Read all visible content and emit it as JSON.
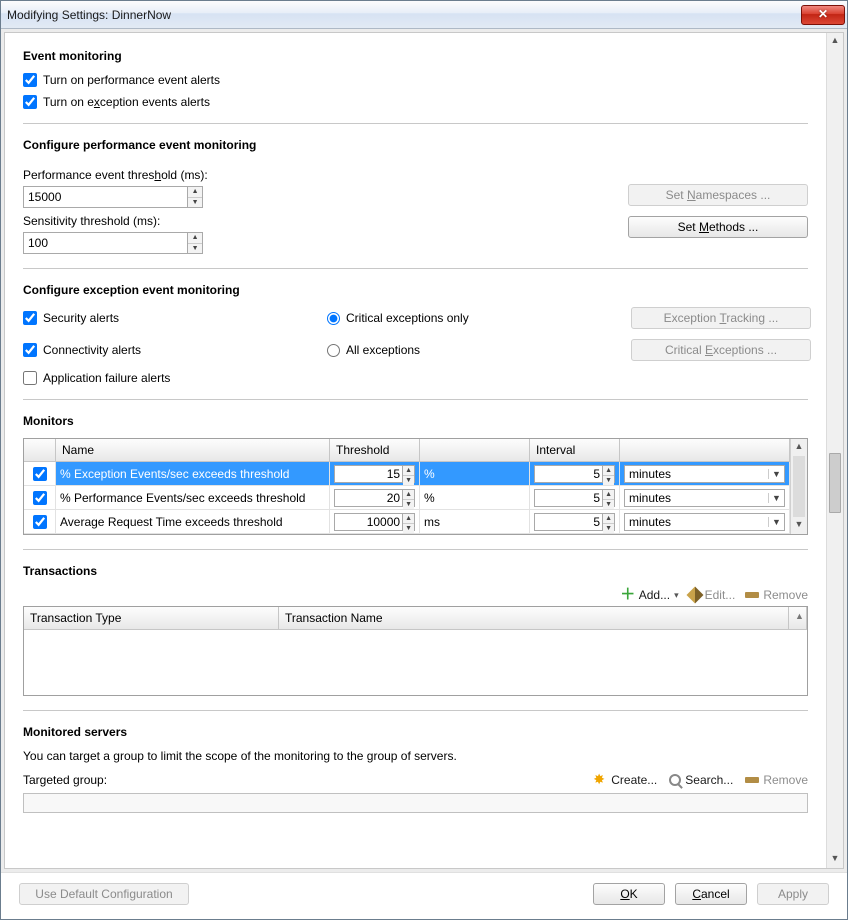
{
  "window": {
    "title": "Modifying Settings: DinnerNow"
  },
  "event_monitoring": {
    "heading": "Event monitoring",
    "perf_alerts_label": "Turn on performance event alerts",
    "perf_alerts_checked": true,
    "exc_alerts_label": "Turn on exception events alerts",
    "exc_alerts_checked": true
  },
  "configure_perf": {
    "heading": "Configure performance event monitoring",
    "threshold_label": "Performance event threshold (ms):",
    "threshold_value": "15000",
    "sensitivity_label": "Sensitivity threshold (ms):",
    "sensitivity_value": "100",
    "set_namespaces_label": "Set Namespaces ...",
    "set_methods_label": "Set Methods ..."
  },
  "configure_exc": {
    "heading": "Configure exception event monitoring",
    "security_label": "Security alerts",
    "security_checked": true,
    "connectivity_label": "Connectivity alerts",
    "connectivity_checked": true,
    "appfail_label": "Application failure alerts",
    "appfail_checked": false,
    "critical_only_label": "Critical exceptions only",
    "all_exceptions_label": "All exceptions",
    "radio_value": "critical",
    "exception_tracking_label": "Exception Tracking ...",
    "critical_exceptions_label": "Critical Exceptions ..."
  },
  "monitors": {
    "heading": "Monitors",
    "columns": {
      "name": "Name",
      "threshold": "Threshold",
      "interval": "Interval"
    },
    "rows": [
      {
        "checked": true,
        "name": "% Exception Events/sec exceeds threshold",
        "threshold": "15",
        "unit": "%",
        "interval": "5",
        "interval_unit": "minutes",
        "selected": true
      },
      {
        "checked": true,
        "name": "% Performance Events/sec exceeds threshold",
        "threshold": "20",
        "unit": "%",
        "interval": "5",
        "interval_unit": "minutes",
        "selected": false
      },
      {
        "checked": true,
        "name": "Average Request Time exceeds threshold",
        "threshold": "10000",
        "unit": "ms",
        "interval": "5",
        "interval_unit": "minutes",
        "selected": false
      }
    ]
  },
  "transactions": {
    "heading": "Transactions",
    "add_label": "Add...",
    "edit_label": "Edit...",
    "remove_label": "Remove",
    "col_type": "Transaction Type",
    "col_name": "Transaction Name"
  },
  "monitored_servers": {
    "heading": "Monitored servers",
    "description": "You can target a group to limit the scope of the monitoring to the group of servers.",
    "targeted_label": "Targeted group:",
    "create_label": "Create...",
    "search_label": "Search...",
    "remove_label": "Remove"
  },
  "buttons": {
    "use_default": "Use Default Configuration",
    "ok": "OK",
    "cancel": "Cancel",
    "apply": "Apply"
  }
}
